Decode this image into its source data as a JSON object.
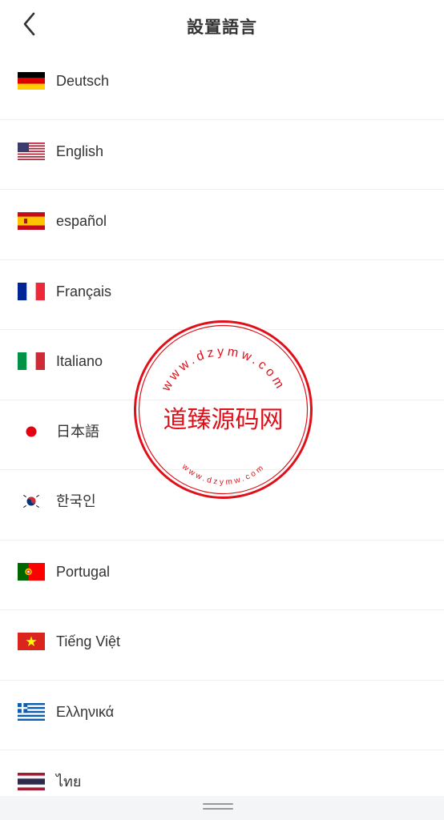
{
  "header": {
    "title": "設置語言",
    "back_icon": "chevron-left-icon"
  },
  "languages": [
    {
      "label": "Deutsch",
      "flag": "germany-flag-icon"
    },
    {
      "label": "English",
      "flag": "usa-flag-icon"
    },
    {
      "label": "español",
      "flag": "spain-flag-icon"
    },
    {
      "label": "Français",
      "flag": "france-flag-icon"
    },
    {
      "label": "Italiano",
      "flag": "italy-flag-icon"
    },
    {
      "label": "日本語",
      "flag": "japan-flag-icon"
    },
    {
      "label": "한국인",
      "flag": "korea-flag-icon"
    },
    {
      "label": "Portugal",
      "flag": "portugal-flag-icon"
    },
    {
      "label": "Tiếng Việt",
      "flag": "vietnam-flag-icon"
    },
    {
      "label": "Ελληνικά",
      "flag": "greece-flag-icon"
    },
    {
      "label": "ไทย",
      "flag": "thailand-flag-icon"
    }
  ],
  "watermark": {
    "center_text": "道臻源码网",
    "ring_text_top": "www.dzymw.com",
    "ring_text_bottom": "www.dzymw.com",
    "color": "#e0101a"
  },
  "bottom_bar": {
    "handle_icon": "drag-handle-icon"
  }
}
